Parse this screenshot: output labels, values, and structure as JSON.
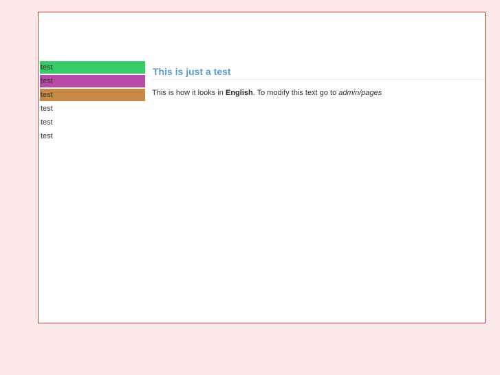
{
  "sidebar": {
    "items": [
      {
        "label": "test",
        "color": "#33cc66"
      },
      {
        "label": "test",
        "color": "#b74aa8"
      },
      {
        "label": "test",
        "color": "#c68a45"
      },
      {
        "label": "test",
        "color": ""
      },
      {
        "label": "test",
        "color": ""
      },
      {
        "label": "test",
        "color": ""
      }
    ]
  },
  "main": {
    "title": "This is just a test",
    "text_before": "This is how it looks in ",
    "text_bold": "English",
    "text_middle": ". To modify this text go to ",
    "text_italic": "admin/pages"
  },
  "colors": {
    "frame_border": "#c0392b",
    "title": "#5b9bd1",
    "background": "#fde9e9"
  }
}
